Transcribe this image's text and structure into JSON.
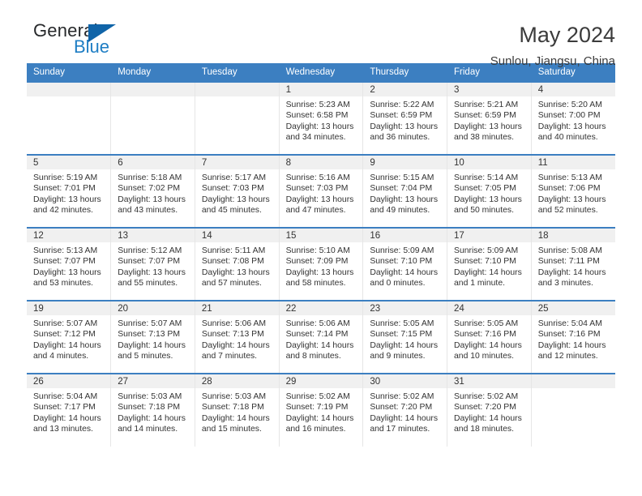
{
  "logo": {
    "text_top": "General",
    "text_bottom": "Blue",
    "accent_color": "#1064a8",
    "blue_color": "#1f7ec4"
  },
  "header": {
    "title": "May 2024",
    "subtitle": "Sunlou, Jiangsu, China"
  },
  "theme": {
    "header_blue": "#3c7fc1",
    "daynum_band": "#f0f0f0",
    "text": "#333333"
  },
  "weekdays": [
    "Sunday",
    "Monday",
    "Tuesday",
    "Wednesday",
    "Thursday",
    "Friday",
    "Saturday"
  ],
  "labels": {
    "sunrise": "Sunrise:",
    "sunset": "Sunset:",
    "daylight": "Daylight:"
  },
  "weeks": [
    [
      {
        "day": ""
      },
      {
        "day": ""
      },
      {
        "day": ""
      },
      {
        "day": "1",
        "sunrise": "Sunrise: 5:23 AM",
        "sunset": "Sunset: 6:58 PM",
        "daylight": "Daylight: 13 hours and 34 minutes."
      },
      {
        "day": "2",
        "sunrise": "Sunrise: 5:22 AM",
        "sunset": "Sunset: 6:59 PM",
        "daylight": "Daylight: 13 hours and 36 minutes."
      },
      {
        "day": "3",
        "sunrise": "Sunrise: 5:21 AM",
        "sunset": "Sunset: 6:59 PM",
        "daylight": "Daylight: 13 hours and 38 minutes."
      },
      {
        "day": "4",
        "sunrise": "Sunrise: 5:20 AM",
        "sunset": "Sunset: 7:00 PM",
        "daylight": "Daylight: 13 hours and 40 minutes."
      }
    ],
    [
      {
        "day": "5",
        "sunrise": "Sunrise: 5:19 AM",
        "sunset": "Sunset: 7:01 PM",
        "daylight": "Daylight: 13 hours and 42 minutes."
      },
      {
        "day": "6",
        "sunrise": "Sunrise: 5:18 AM",
        "sunset": "Sunset: 7:02 PM",
        "daylight": "Daylight: 13 hours and 43 minutes."
      },
      {
        "day": "7",
        "sunrise": "Sunrise: 5:17 AM",
        "sunset": "Sunset: 7:03 PM",
        "daylight": "Daylight: 13 hours and 45 minutes."
      },
      {
        "day": "8",
        "sunrise": "Sunrise: 5:16 AM",
        "sunset": "Sunset: 7:03 PM",
        "daylight": "Daylight: 13 hours and 47 minutes."
      },
      {
        "day": "9",
        "sunrise": "Sunrise: 5:15 AM",
        "sunset": "Sunset: 7:04 PM",
        "daylight": "Daylight: 13 hours and 49 minutes."
      },
      {
        "day": "10",
        "sunrise": "Sunrise: 5:14 AM",
        "sunset": "Sunset: 7:05 PM",
        "daylight": "Daylight: 13 hours and 50 minutes."
      },
      {
        "day": "11",
        "sunrise": "Sunrise: 5:13 AM",
        "sunset": "Sunset: 7:06 PM",
        "daylight": "Daylight: 13 hours and 52 minutes."
      }
    ],
    [
      {
        "day": "12",
        "sunrise": "Sunrise: 5:13 AM",
        "sunset": "Sunset: 7:07 PM",
        "daylight": "Daylight: 13 hours and 53 minutes."
      },
      {
        "day": "13",
        "sunrise": "Sunrise: 5:12 AM",
        "sunset": "Sunset: 7:07 PM",
        "daylight": "Daylight: 13 hours and 55 minutes."
      },
      {
        "day": "14",
        "sunrise": "Sunrise: 5:11 AM",
        "sunset": "Sunset: 7:08 PM",
        "daylight": "Daylight: 13 hours and 57 minutes."
      },
      {
        "day": "15",
        "sunrise": "Sunrise: 5:10 AM",
        "sunset": "Sunset: 7:09 PM",
        "daylight": "Daylight: 13 hours and 58 minutes."
      },
      {
        "day": "16",
        "sunrise": "Sunrise: 5:09 AM",
        "sunset": "Sunset: 7:10 PM",
        "daylight": "Daylight: 14 hours and 0 minutes."
      },
      {
        "day": "17",
        "sunrise": "Sunrise: 5:09 AM",
        "sunset": "Sunset: 7:10 PM",
        "daylight": "Daylight: 14 hours and 1 minute."
      },
      {
        "day": "18",
        "sunrise": "Sunrise: 5:08 AM",
        "sunset": "Sunset: 7:11 PM",
        "daylight": "Daylight: 14 hours and 3 minutes."
      }
    ],
    [
      {
        "day": "19",
        "sunrise": "Sunrise: 5:07 AM",
        "sunset": "Sunset: 7:12 PM",
        "daylight": "Daylight: 14 hours and 4 minutes."
      },
      {
        "day": "20",
        "sunrise": "Sunrise: 5:07 AM",
        "sunset": "Sunset: 7:13 PM",
        "daylight": "Daylight: 14 hours and 5 minutes."
      },
      {
        "day": "21",
        "sunrise": "Sunrise: 5:06 AM",
        "sunset": "Sunset: 7:13 PM",
        "daylight": "Daylight: 14 hours and 7 minutes."
      },
      {
        "day": "22",
        "sunrise": "Sunrise: 5:06 AM",
        "sunset": "Sunset: 7:14 PM",
        "daylight": "Daylight: 14 hours and 8 minutes."
      },
      {
        "day": "23",
        "sunrise": "Sunrise: 5:05 AM",
        "sunset": "Sunset: 7:15 PM",
        "daylight": "Daylight: 14 hours and 9 minutes."
      },
      {
        "day": "24",
        "sunrise": "Sunrise: 5:05 AM",
        "sunset": "Sunset: 7:16 PM",
        "daylight": "Daylight: 14 hours and 10 minutes."
      },
      {
        "day": "25",
        "sunrise": "Sunrise: 5:04 AM",
        "sunset": "Sunset: 7:16 PM",
        "daylight": "Daylight: 14 hours and 12 minutes."
      }
    ],
    [
      {
        "day": "26",
        "sunrise": "Sunrise: 5:04 AM",
        "sunset": "Sunset: 7:17 PM",
        "daylight": "Daylight: 14 hours and 13 minutes."
      },
      {
        "day": "27",
        "sunrise": "Sunrise: 5:03 AM",
        "sunset": "Sunset: 7:18 PM",
        "daylight": "Daylight: 14 hours and 14 minutes."
      },
      {
        "day": "28",
        "sunrise": "Sunrise: 5:03 AM",
        "sunset": "Sunset: 7:18 PM",
        "daylight": "Daylight: 14 hours and 15 minutes."
      },
      {
        "day": "29",
        "sunrise": "Sunrise: 5:02 AM",
        "sunset": "Sunset: 7:19 PM",
        "daylight": "Daylight: 14 hours and 16 minutes."
      },
      {
        "day": "30",
        "sunrise": "Sunrise: 5:02 AM",
        "sunset": "Sunset: 7:20 PM",
        "daylight": "Daylight: 14 hours and 17 minutes."
      },
      {
        "day": "31",
        "sunrise": "Sunrise: 5:02 AM",
        "sunset": "Sunset: 7:20 PM",
        "daylight": "Daylight: 14 hours and 18 minutes."
      },
      {
        "day": ""
      }
    ]
  ]
}
